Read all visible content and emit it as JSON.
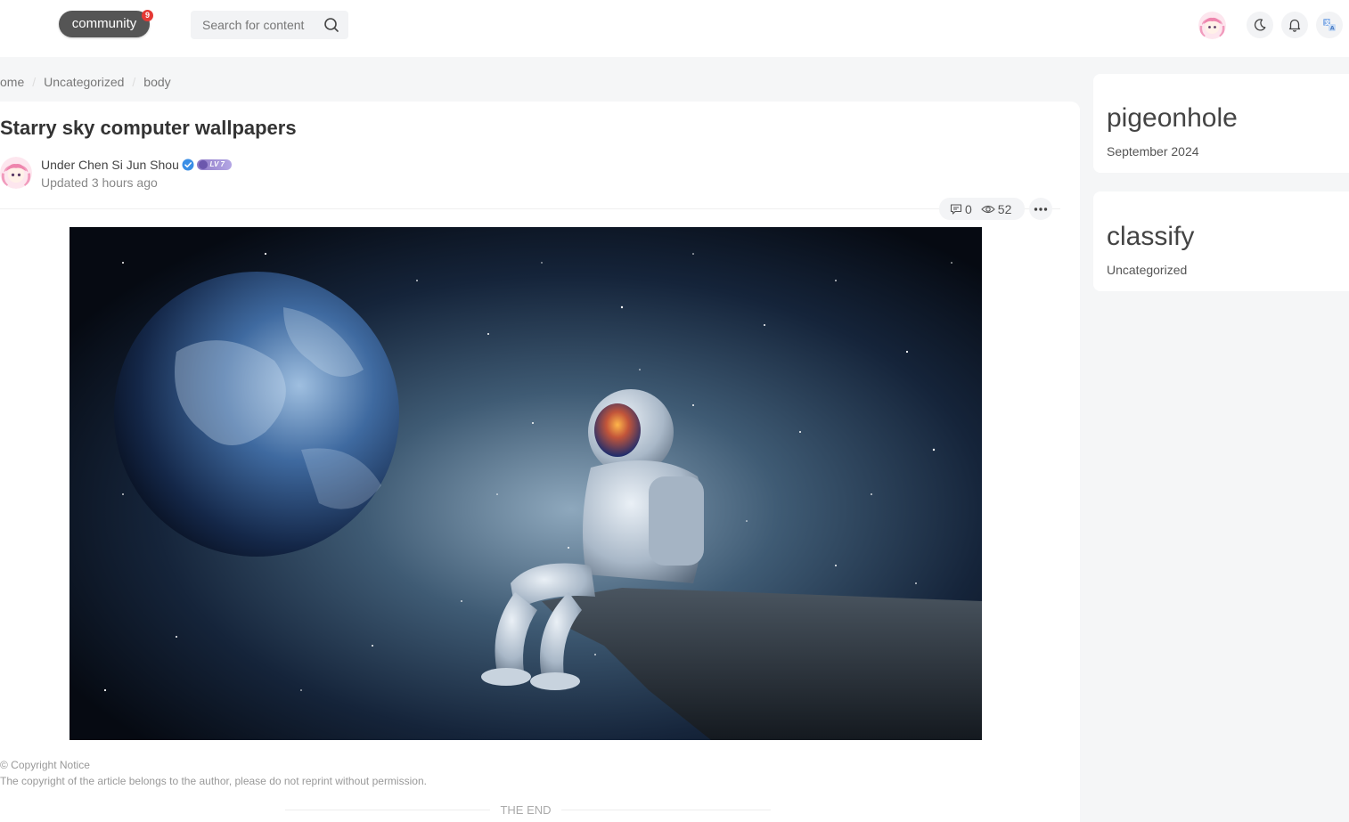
{
  "header": {
    "logo_label": "community",
    "logo_badge": "9",
    "search": {
      "placeholder": "Search for content",
      "icon": "search-icon"
    },
    "icons": [
      "avatar",
      "moon-icon",
      "bell-icon",
      "translate-icon"
    ]
  },
  "breadcrumb": [
    "ome",
    "Uncategorized",
    "body"
  ],
  "article": {
    "title": "Starry sky computer wallpapers",
    "author": "Under Chen Si Jun Shou",
    "level": "LV 7",
    "updated": "Updated 3 hours ago",
    "comments": "0",
    "views": "52",
    "copyright_title": "© Copyright Notice",
    "copyright_text": "The copyright of the article belongs to the author, please do not reprint without permission.",
    "end_label": "THE END"
  },
  "sidebar": {
    "archive": {
      "title": "pigeonhole",
      "items": [
        "September 2024"
      ]
    },
    "categories": {
      "title": "classify",
      "items": [
        "Uncategorized"
      ]
    }
  },
  "colors": {
    "page_bg": "#f5f6f7",
    "logo_bg": "#555555",
    "badge": "#e53935",
    "verify": "#3a8ee6"
  }
}
